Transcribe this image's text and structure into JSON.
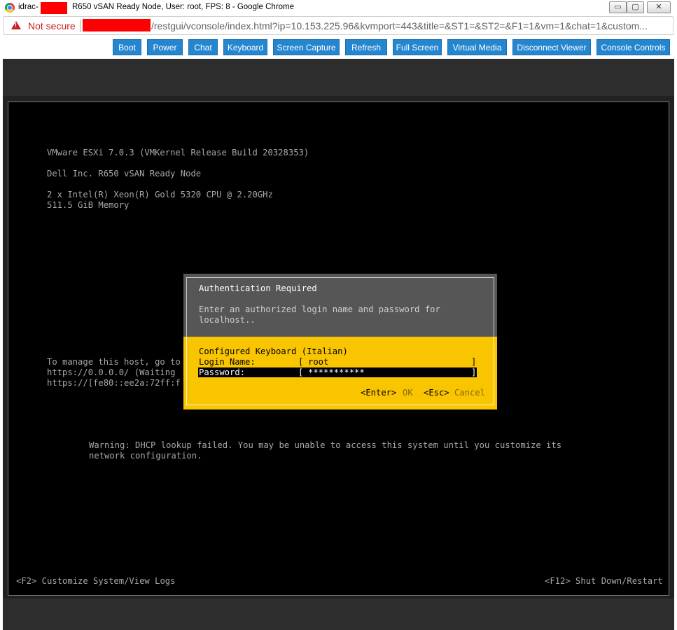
{
  "window": {
    "title_prefix": "idrac-",
    "title_rest": "R650 vSAN Ready Node, User: root, FPS: 8 - Google Chrome",
    "min": "▭",
    "max": "▢",
    "close": "✕"
  },
  "address": {
    "security_label": "Not secure",
    "url": "/restgui/vconsole/index.html?ip=10.153.225.96&kvmport=443&title=&ST1=&ST2=&F1=1&vm=1&chat=1&custom..."
  },
  "toolbar": {
    "buttons": [
      "Boot",
      "Power",
      "Chat",
      "Keyboard",
      "Screen Capture",
      "Refresh",
      "Full Screen",
      "Virtual Media",
      "Disconnect Viewer",
      "Console Controls"
    ],
    "color": "#2586d0"
  },
  "console": {
    "version": "VMware ESXi 7.0.3 (VMKernel Release Build 20328353)",
    "vendor": "Dell Inc. R650 vSAN Ready Node",
    "cpu": "2 x Intel(R) Xeon(R) Gold 5320 CPU @ 2.20GHz",
    "memory": "511.5 GiB Memory",
    "manage_line1": "To manage this host, go to",
    "manage_line2": "https://0.0.0.0/ (Waiting",
    "manage_line3": "https://[fe80::ee2a:72ff:f",
    "warning_line1": "Warning: DHCP lookup failed. You may be unable to access this system until you customize its",
    "warning_line2": "network configuration.",
    "footer_left": "<F2> Customize System/View Logs",
    "footer_right": "<F12> Shut Down/Restart"
  },
  "dialog": {
    "title": "Authentication Required",
    "message_line1": "Enter an authorized login name and password for",
    "message_line2": "localhost..",
    "keyboard": "Configured Keyboard (Italian)",
    "login_label": "Login Name:",
    "login_open": "[",
    "login_value": "root",
    "login_close": "]",
    "password_label": "Password:",
    "password_open": "[",
    "password_value": "***********",
    "password_close": "]",
    "enter_key": "<Enter>",
    "ok": "OK",
    "esc_key": "<Esc>",
    "cancel": "Cancel",
    "accent": "#f9c400",
    "header_bg": "#565656"
  }
}
